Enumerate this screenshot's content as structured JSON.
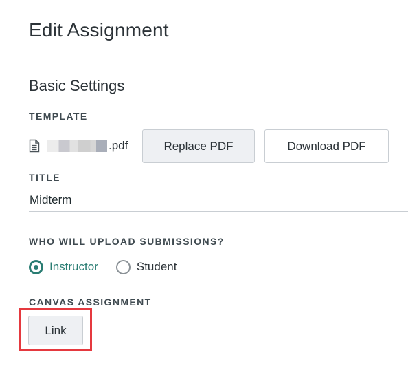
{
  "page": {
    "title": "Edit Assignment"
  },
  "basic_settings": {
    "title": "Basic Settings",
    "template_label": "TEMPLATE",
    "file_extension": ".pdf",
    "file_icon": "document-icon",
    "replace_button": "Replace PDF",
    "download_button": "Download PDF"
  },
  "title_field": {
    "label": "TITLE",
    "value": "Midterm"
  },
  "submissions": {
    "label": "WHO WILL UPLOAD SUBMISSIONS?",
    "options": [
      {
        "label": "Instructor",
        "selected": true
      },
      {
        "label": "Student",
        "selected": false
      }
    ],
    "accent_color": "#2a7d73"
  },
  "canvas_assignment": {
    "label": "CANVAS ASSIGNMENT",
    "link_button": "Link",
    "highlight_color": "#e5393f"
  }
}
